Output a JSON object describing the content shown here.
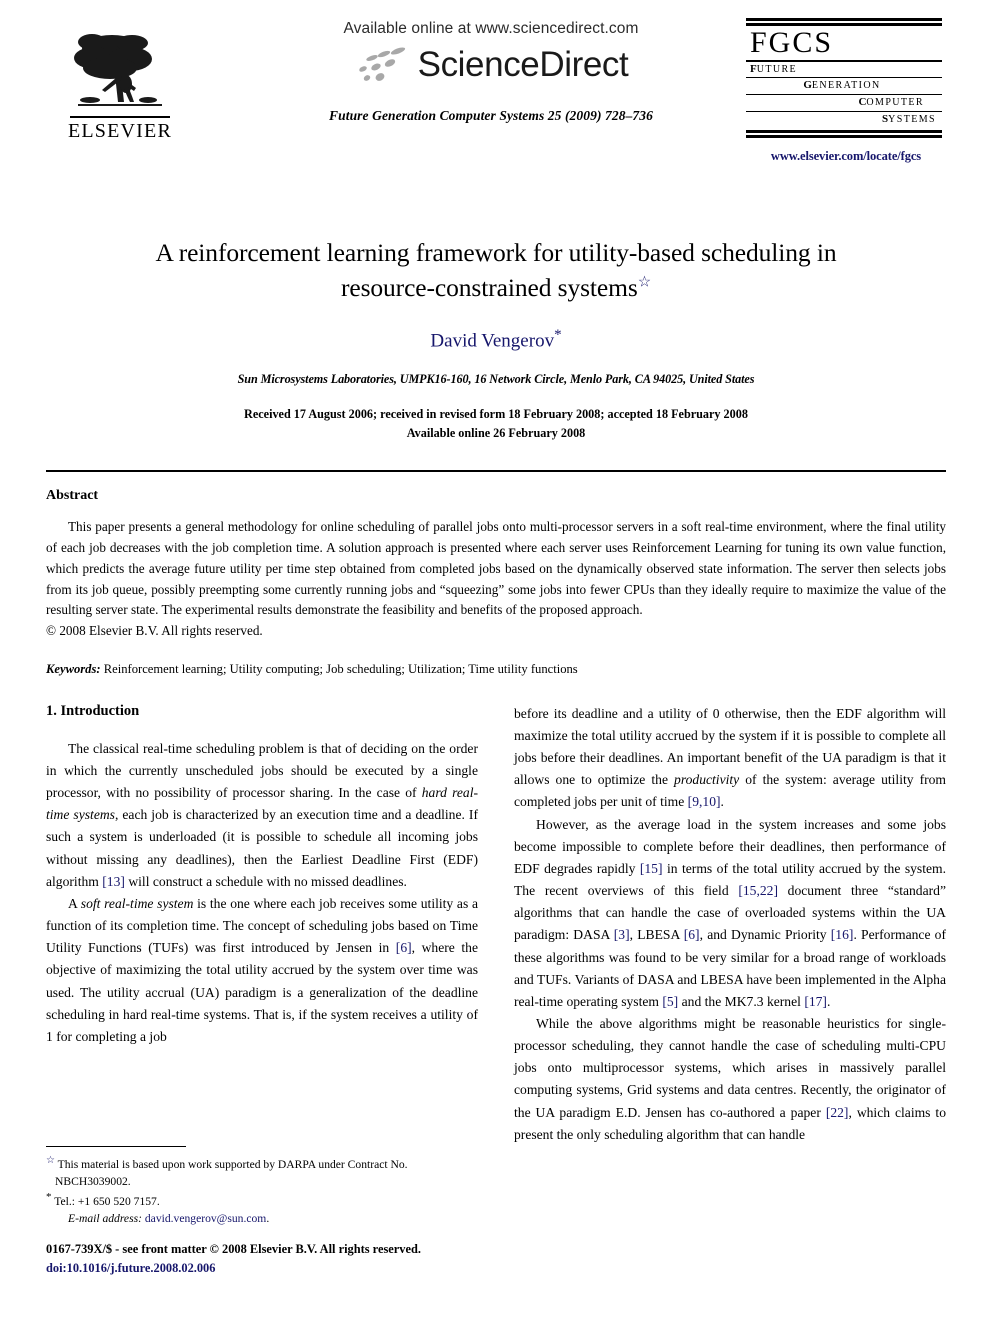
{
  "masthead": {
    "publisher_name": "ELSEVIER",
    "available_online": "Available online at www.sciencedirect.com",
    "sciencedirect_wordmark": "ScienceDirect",
    "journal_reference": "Future Generation Computer Systems 25 (2009) 728–736",
    "journal_logo": {
      "acronym": "FGCS",
      "line1_initial": "F",
      "line1_rest": "UTURE",
      "line2_initial": "G",
      "line2_rest": "ENERATION",
      "line3_initial": "C",
      "line3_rest": "OMPUTER",
      "line4_initial": "S",
      "line4_rest": "YSTEMS"
    },
    "journal_url": "www.elsevier.com/locate/fgcs"
  },
  "title_block": {
    "title_line1": "A reinforcement learning framework for utility-based scheduling in",
    "title_line2": "resource-constrained systems",
    "title_footnote_marker": "☆",
    "author": "David Vengerov",
    "author_footnote_marker": "*",
    "affiliation": "Sun Microsystems Laboratories, UMPK16-160, 16 Network Circle, Menlo Park, CA 94025, United States",
    "history_line1": "Received 17 August 2006; received in revised form 18 February 2008; accepted 18 February 2008",
    "history_line2": "Available online 26 February 2008"
  },
  "abstract": {
    "heading": "Abstract",
    "body": "This paper presents a general methodology for online scheduling of parallel jobs onto multi-processor servers in a soft real-time environment, where the final utility of each job decreases with the job completion time. A solution approach is presented where each server uses Reinforcement Learning for tuning its own value function, which predicts the average future utility per time step obtained from completed jobs based on the dynamically observed state information. The server then selects jobs from its job queue, possibly preempting some currently running jobs and “squeezing” some jobs into fewer CPUs than they ideally require to maximize the value of the resulting server state. The experimental results demonstrate the feasibility and benefits of the proposed approach.",
    "copyright": "© 2008 Elsevier B.V. All rights reserved."
  },
  "keywords": {
    "label": "Keywords:",
    "value": "Reinforcement learning; Utility computing; Job scheduling; Utilization; Time utility functions"
  },
  "body": {
    "section_heading": "1. Introduction",
    "left_column": {
      "para1_a": "The classical real-time scheduling problem is that of deciding on the order in which the currently unscheduled jobs should be executed by a single processor, with no possibility of processor sharing. In the case of ",
      "para1_italic": "hard real-time systems",
      "para1_b": ", each job is characterized by an execution time and a deadline. If such a system is underloaded (it is possible to schedule all incoming jobs without missing any deadlines), then the Earliest Deadline First (EDF) algorithm ",
      "para1_cite1": "[13]",
      "para1_c": " will construct a schedule with no missed deadlines.",
      "para2_a": "A ",
      "para2_italic": "soft real-time system",
      "para2_b": " is the one where each job receives some utility as a function of its completion time. The concept of scheduling jobs based on Time Utility Functions (TUFs) was first introduced by Jensen in ",
      "para2_cite1": "[6]",
      "para2_c": ", where the objective of maximizing the total utility accrued by the system over time was used. The utility accrual (UA) paradigm is a generalization of the deadline scheduling in hard real-time systems. That is, if the system receives a utility of 1 for completing a job"
    },
    "right_column": {
      "para1_a": "before its deadline and a utility of 0 otherwise, then the EDF algorithm will maximize the total utility accrued by the system if it is possible to complete all jobs before their deadlines. An important benefit of the UA paradigm is that it allows one to optimize the ",
      "para1_italic": "productivity",
      "para1_b": " of the system: average utility from completed jobs per unit of time ",
      "para1_cite1": "[9,10]",
      "para1_c": ".",
      "para2_a": "However, as the average load in the system increases and some jobs become impossible to complete before their deadlines, then performance of EDF degrades rapidly ",
      "para2_cite1": "[15]",
      "para2_b": " in terms of the total utility accrued by the system. The recent overviews of this field ",
      "para2_cite2": "[15,22]",
      "para2_c": " document three “standard” algorithms that can handle the case of overloaded systems within the UA paradigm: DASA ",
      "para2_cite3": "[3]",
      "para2_d": ", LBESA ",
      "para2_cite4": "[6]",
      "para2_e": ", and Dynamic Priority ",
      "para2_cite5": "[16]",
      "para2_f": ". Performance of these algorithms was found to be very similar for a broad range of workloads and TUFs. Variants of DASA and LBESA have been implemented in the Alpha real-time operating system ",
      "para2_cite6": "[5]",
      "para2_g": " and the MK7.3 kernel ",
      "para2_cite7": "[17]",
      "para2_h": ".",
      "para3_a": "While the above algorithms might be reasonable heuristics for  single-processor scheduling, they cannot handle the case of scheduling multi-CPU jobs onto multiprocessor systems, which arises in massively parallel computing systems, Grid systems and data centres. Recently, the originator of the UA paradigm E.D. Jensen has co-authored a paper ",
      "para3_cite1": "[22]",
      "para3_b": ", which claims to present the only scheduling algorithm that can handle"
    }
  },
  "footnotes": {
    "funding_marker": "☆",
    "funding_text": " This material is based upon work supported by DARPA under Contract No. NBCH3039002.",
    "corresponding_marker": "*",
    "tel_text": " Tel.: +1 650 520 7157.",
    "email_label": "E-mail address:",
    "email_value": "david.vengerov@sun.com",
    "email_trailing": "."
  },
  "imprint": {
    "issn_line": "0167-739X/$ - see front matter © 2008 Elsevier B.V. All rights reserved.",
    "doi": "doi:10.1016/j.future.2008.02.006"
  },
  "colors": {
    "link_blue": "#16166b",
    "text_black": "#000000",
    "page_background": "#ffffff"
  }
}
